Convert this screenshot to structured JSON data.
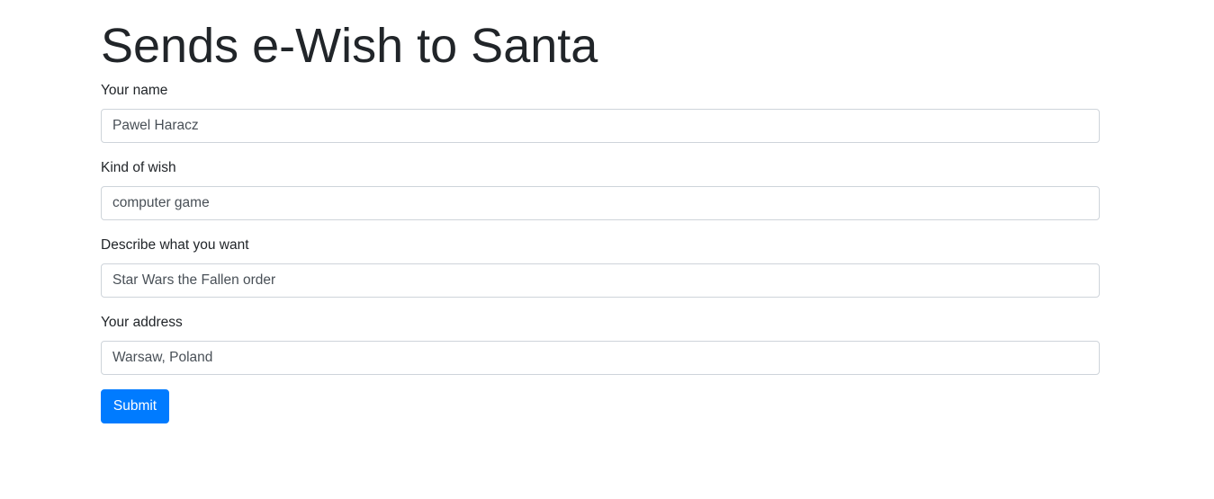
{
  "page": {
    "title": "Sends e-Wish to Santa"
  },
  "form": {
    "fields": [
      {
        "label": "Your name",
        "value": "Pawel Haracz"
      },
      {
        "label": "Kind of wish",
        "value": "computer game"
      },
      {
        "label": "Describe what you want",
        "value": "Star Wars the Fallen order"
      },
      {
        "label": "Your address",
        "value": "Warsaw, Poland"
      }
    ],
    "submit_label": "Submit"
  },
  "colors": {
    "primary": "#007bff",
    "text": "#212529",
    "input_text": "#495057",
    "input_border": "#ced4da"
  }
}
